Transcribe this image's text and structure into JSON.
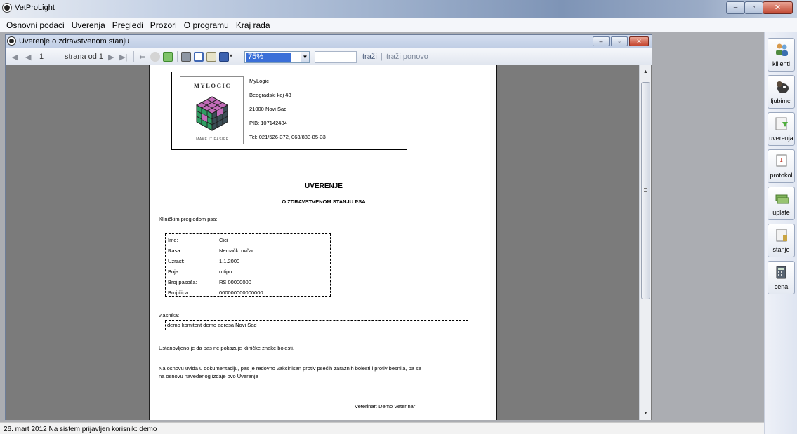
{
  "app": {
    "title": "VetProLight"
  },
  "menu": {
    "items": [
      "Osnovni podaci",
      "Uverenja",
      "Pregledi",
      "Prozori",
      "O programu",
      "Kraj rada"
    ]
  },
  "child_window": {
    "title": "Uverenje o zdravstvenom stanju"
  },
  "toolbar": {
    "page_current": "1",
    "page_of_label": "strana od 1",
    "zoom_value": "75%",
    "find_label": "traži",
    "find_next_label": "traži ponovo"
  },
  "report": {
    "company": {
      "logo_name": "MyLogic",
      "logo_slogan": "Make IT easier",
      "name": "MyLogic",
      "address": "Beogradski kej 43",
      "city": "21000 Novi Sad",
      "pib": "PIB: 107142484",
      "phone": "Tel: 021/526-372, 063/883-85-33"
    },
    "heading": "UVERENJE",
    "subheading": "O ZDRAVSTVENOM STANJU PSA",
    "intro": "Kliničkim pregledom psa:",
    "animal": {
      "ime_label": "Ime:",
      "ime": "Cici",
      "rasa_label": "Rasa:",
      "rasa": "Nemački ovčar",
      "uzrast_label": "Uzrast:",
      "uzrast": "1.1.2000",
      "boja_label": "Boja:",
      "boja": "u tipu",
      "pasos_label": "Broj pasoša:",
      "pasos": "RS 00000000",
      "cip_label": "Broj čipa:",
      "cip": "000000000000000"
    },
    "owner_label": "vlasnika:",
    "owner": "demo komitent  demo adresa  Novi Sad",
    "finding": "Ustanovljeno je da pas ne pokazuje kliničke znake bolesti.",
    "conclusion_line1": "Na osnovu uvida u dokumentaciju, pas je redovno vakcinisan protiv psećih zaraznih bolesti i protiv besnila, pa se",
    "conclusion_line2": "na osnovu navedenog izdaje ovo Uverenje",
    "vet": "Veterinar: Demo Veterinar"
  },
  "sidebar": {
    "items": [
      {
        "label": "klijenti",
        "icon": "people-icon"
      },
      {
        "label": "ljubimci",
        "icon": "pet-icon"
      },
      {
        "label": "uverenja",
        "icon": "certificate-icon"
      },
      {
        "label": "protokol",
        "icon": "calendar-icon"
      },
      {
        "label": "uplate",
        "icon": "money-icon"
      },
      {
        "label": "stanje",
        "icon": "report-icon"
      },
      {
        "label": "cena",
        "icon": "calculator-icon"
      }
    ]
  },
  "status": {
    "text": "26. mart 2012  Na sistem prijavljen korisnik:  demo"
  },
  "colors": {
    "accent": "#3a6fd8",
    "viewport": "#7b7b7b",
    "mdi": "#abadb2"
  }
}
